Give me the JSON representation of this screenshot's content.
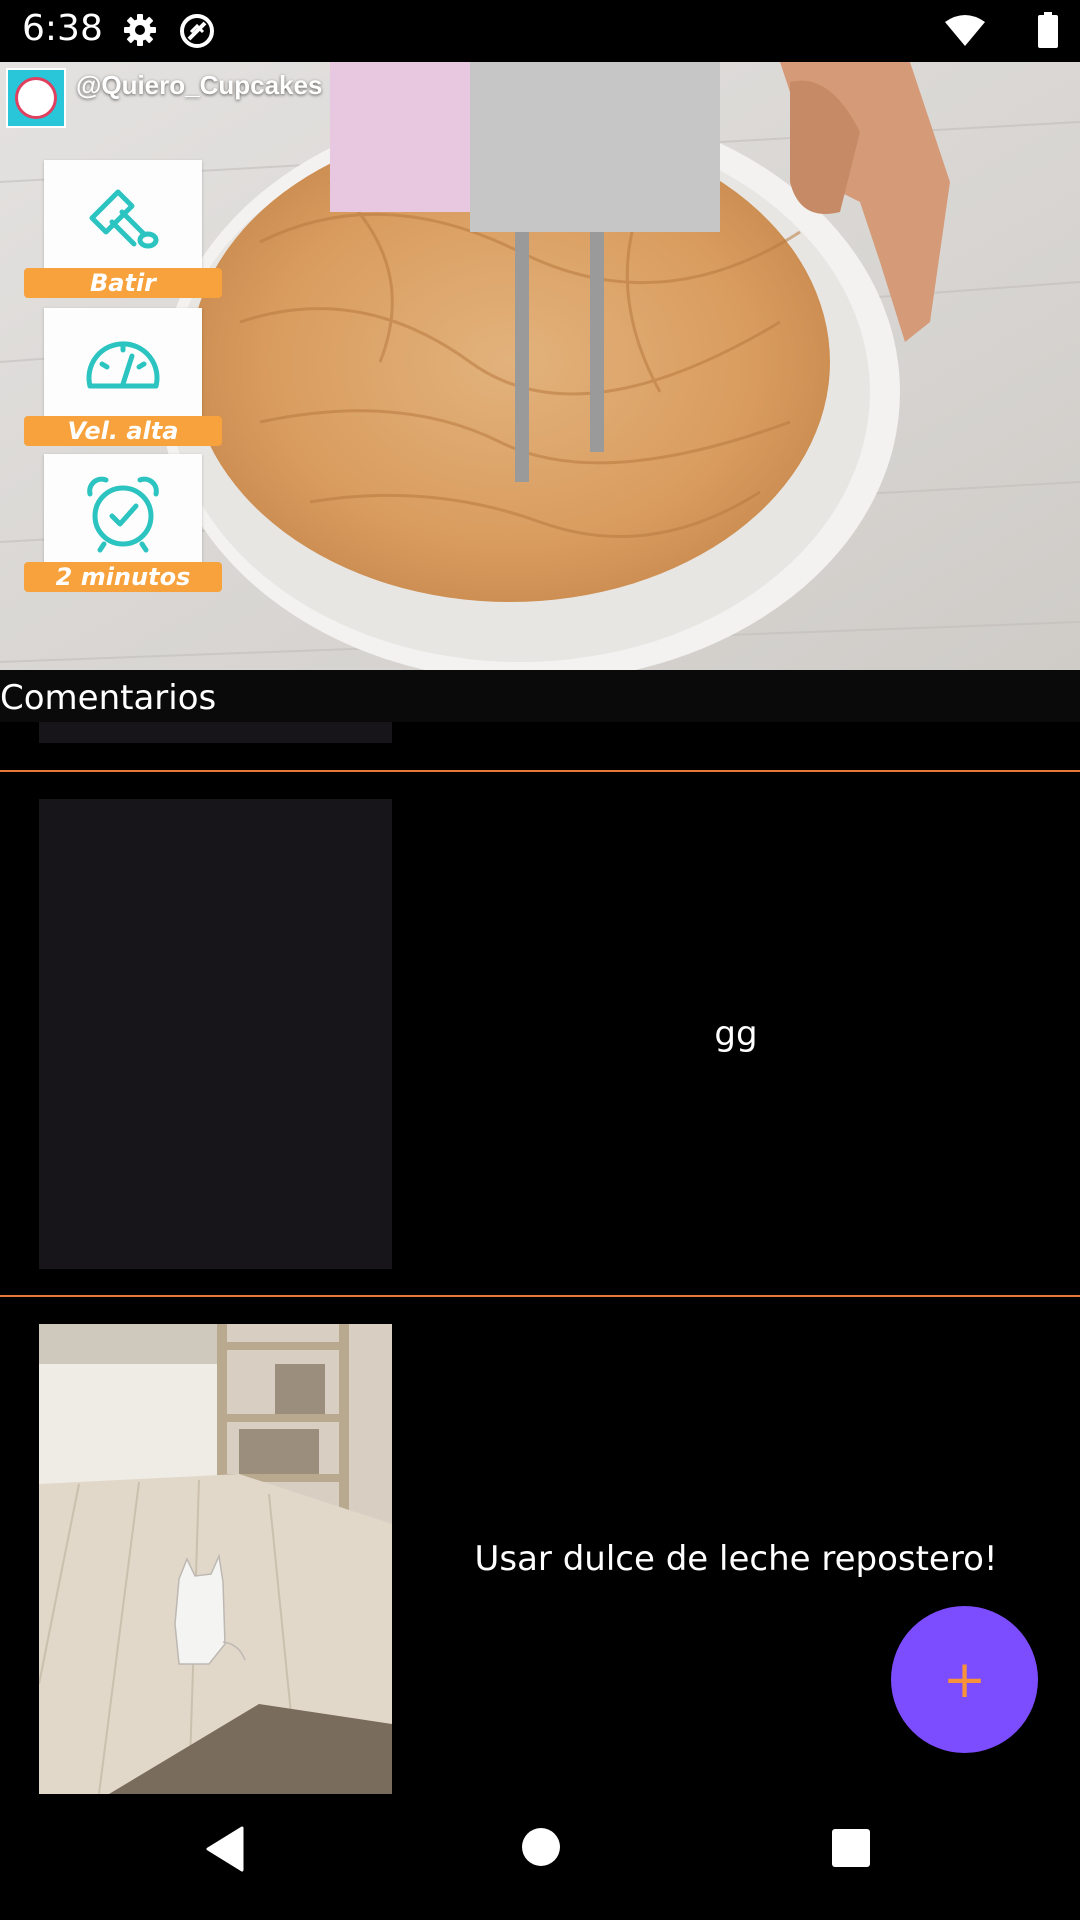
{
  "status_bar": {
    "time": "6:38",
    "icons": [
      "gear-icon",
      "no-disturb-icon",
      "wifi-icon",
      "battery-icon"
    ]
  },
  "video": {
    "channel": "@Quiero_Cupcakes",
    "steps": [
      {
        "label": "Batir",
        "icon": "mixer-icon"
      },
      {
        "label": "Vel. alta",
        "icon": "speedometer-icon"
      },
      {
        "label": "2 minutos",
        "icon": "alarm-clock-icon"
      }
    ]
  },
  "comments": {
    "title": "Comentarios",
    "items": [
      {
        "text": "gg",
        "thumbnail": "empty"
      },
      {
        "text": "Usar dulce de leche repostero!",
        "thumbnail": "cat-room-photo"
      }
    ]
  },
  "fab": {
    "label": "+",
    "icon": "plus-icon"
  },
  "nav": {
    "buttons": [
      "back-icon",
      "home-icon",
      "recents-icon"
    ]
  },
  "colors": {
    "accent": "#7c4dff",
    "divider": "#e8773a",
    "plus": "#f7923a",
    "step_ribbon": "#f7a23c",
    "step_icon": "#2cc4c0"
  }
}
